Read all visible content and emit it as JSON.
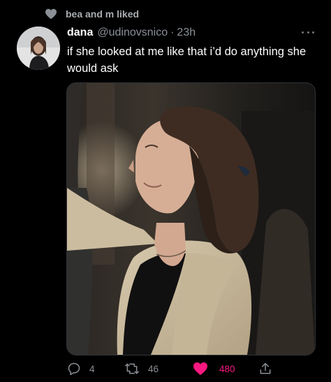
{
  "social_context": {
    "icon": "heart-icon",
    "text": "bea and m liked"
  },
  "tweet": {
    "author_name": "dana",
    "handle": "@udinovsnico",
    "separator": "·",
    "timestamp": "23h",
    "text": "if she looked at me like that i’d do anything she would ask",
    "media": {
      "kind": "photo",
      "icon": "photo"
    }
  },
  "actions": {
    "reply_count": "4",
    "retweet_count": "46",
    "like_count": "480",
    "like_active": true
  },
  "colors": {
    "background": "#000000",
    "text_primary": "#e7e9ea",
    "text_secondary": "#8b9096",
    "like_pink": "#f91880"
  }
}
